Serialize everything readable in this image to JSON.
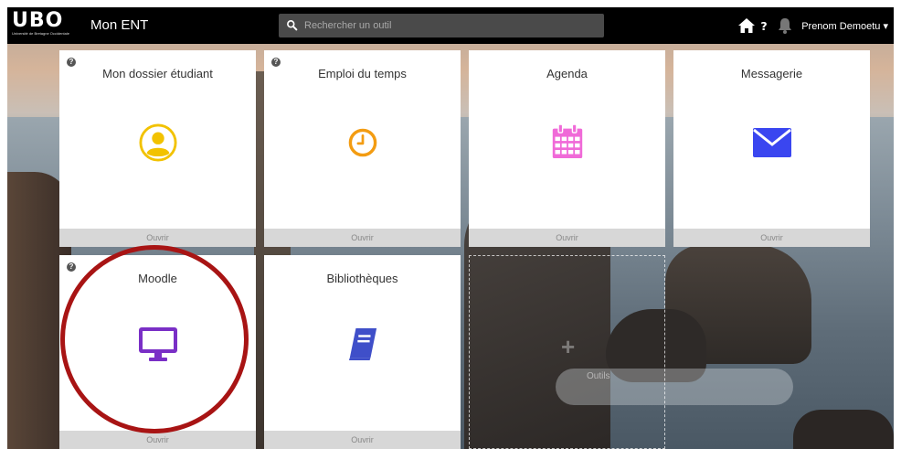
{
  "header": {
    "logo_text": "UBO",
    "logo_subtitle": "Université de Bretagne Occidentale",
    "app_title": "Mon ENT",
    "search_placeholder": "Rechercher un outil",
    "user_name": "Prenom Demoetu",
    "icons": [
      "home-icon",
      "help-icon",
      "bell-icon",
      "caret-down-icon"
    ]
  },
  "tiles": [
    {
      "title": "Mon dossier étudiant",
      "icon": "user-circle-icon",
      "icon_color": "#f2c200",
      "footer": "Ouvrir",
      "help": true
    },
    {
      "title": "Emploi du temps",
      "icon": "clock-icon",
      "icon_color": "#f39c12",
      "footer": "Ouvrir",
      "help": true
    },
    {
      "title": "Agenda",
      "icon": "calendar-icon",
      "icon_color": "#f06ad8",
      "footer": "Ouvrir",
      "help": false
    },
    {
      "title": "Messagerie",
      "icon": "envelope-icon",
      "icon_color": "#3a46f0",
      "footer": "Ouvrir",
      "help": false
    },
    {
      "title": "Moodle",
      "icon": "desktop-icon",
      "icon_color": "#7a2fc6",
      "footer": "Ouvrir",
      "help": true
    },
    {
      "title": "Bibliothèques",
      "icon": "book-icon",
      "icon_color": "#3f4fc9",
      "footer": "Ouvrir",
      "help": false
    }
  ],
  "empty_slot": {
    "label": "Outils"
  },
  "highlight_color": "#a81414"
}
